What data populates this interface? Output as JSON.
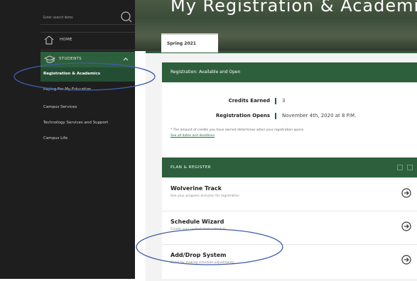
{
  "sidebar": {
    "search": {
      "placeholder": "Enter search items"
    },
    "home": {
      "label": "HOME"
    },
    "students": {
      "label": "STUDENTS"
    },
    "items": [
      {
        "label": "Registration & Academics"
      },
      {
        "label": "Paying For My Education"
      },
      {
        "label": "Campus Services"
      },
      {
        "label": "Technology Services and Support"
      },
      {
        "label": "Campus Life"
      }
    ]
  },
  "header": {
    "title": "My Registration & Academics"
  },
  "tab": {
    "label": "Spring 2021"
  },
  "registration": {
    "header": "Registration: Available and Open",
    "credits_label": "Credits Earned",
    "credits_value": "3",
    "opens_label": "Registration Opens",
    "opens_value": "November 4th, 2020 at 8 P.M.",
    "note": "* The amount of credits you have earned determines when your registration opens.",
    "link": "See all dates and deadlines"
  },
  "plan": {
    "header": "PLAN & REGISTER",
    "tasks": [
      {
        "title": "Wolverine Track",
        "desc": "See your progress and plan for registration"
      },
      {
        "title": "Schedule Wizard",
        "desc": "Create your perfect class schedule"
      },
      {
        "title": "Add/Drop System",
        "desc": "Great for making schedule adjustments"
      }
    ]
  },
  "colors": {
    "sidebar_bg": "#1e1e1e",
    "accent_green": "#2d5f3d",
    "annotation": "#3f5ba9"
  }
}
